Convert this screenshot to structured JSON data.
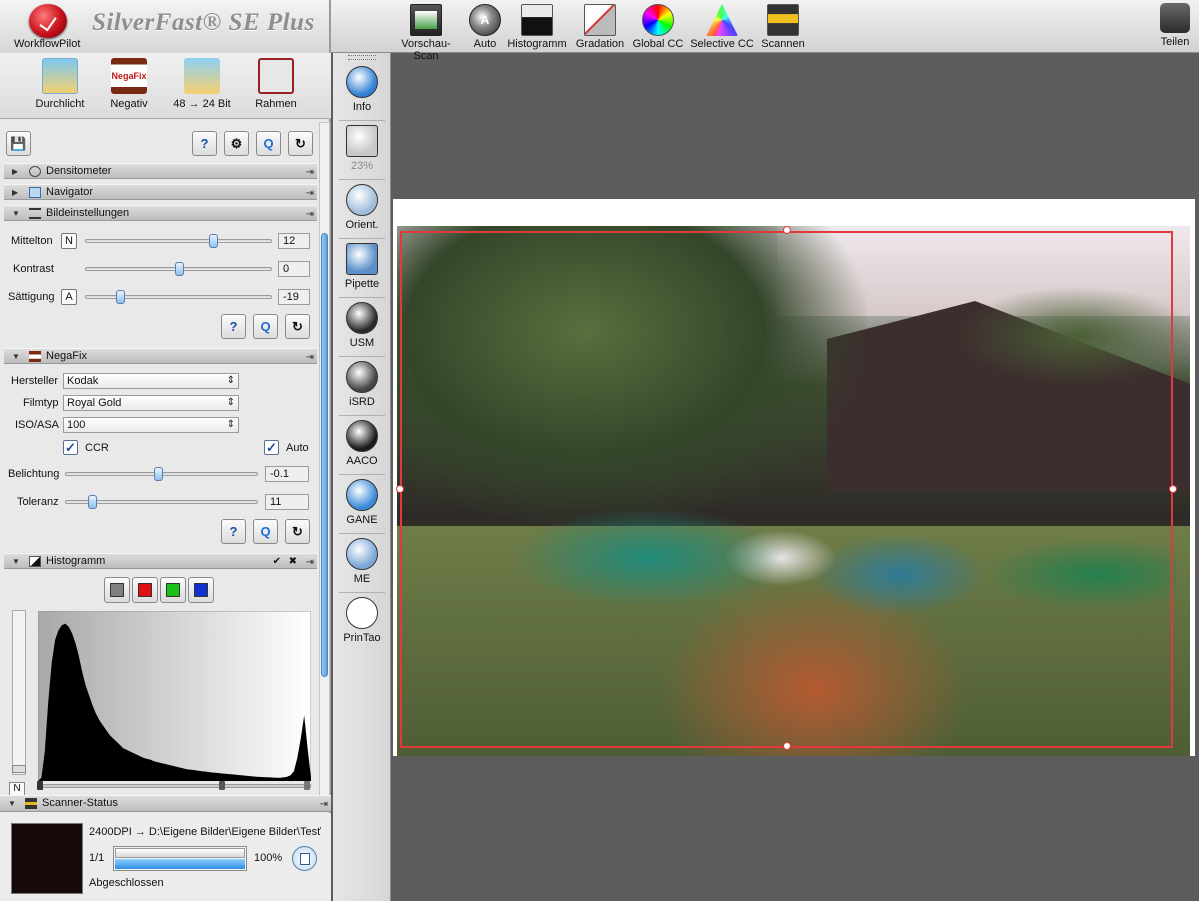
{
  "app": {
    "title": "SilverFast® SE Plus",
    "workflow_label": "WorkflowPilot"
  },
  "top_toolbar": [
    {
      "label": "Vorschau-Scan",
      "icon": "preview-scan-icon"
    },
    {
      "label": "Auto",
      "icon": "auto-icon"
    },
    {
      "label": "Histogramm",
      "icon": "histogram-icon"
    },
    {
      "label": "Gradation",
      "icon": "gradation-icon"
    },
    {
      "label": "Global CC",
      "icon": "global-cc-icon"
    },
    {
      "label": "Selective CC",
      "icon": "selective-cc-icon"
    },
    {
      "label": "Scannen",
      "icon": "scan-icon"
    }
  ],
  "share_label": "Teilen",
  "modes": [
    {
      "label": "Durchlicht",
      "icon": "transparency-icon"
    },
    {
      "label": "Negativ",
      "icon": "negafix-icon",
      "badge": "NegaFix"
    },
    {
      "label": "48 → 24 Bit",
      "icon": "bitdepth-icon"
    },
    {
      "label": "Rahmen",
      "icon": "frame-icon"
    }
  ],
  "sections": {
    "densitometer": "Densitometer",
    "navigator": "Navigator",
    "bildeinstellungen": "Bildeinstellungen",
    "negafix": "NegaFix",
    "histogramm": "Histogramm",
    "scanner_status": "Scanner-Status"
  },
  "image_settings": {
    "mittelton": {
      "label": "Mittelton",
      "letter": "N",
      "value": "12",
      "position": 0.69
    },
    "kontrast": {
      "label": "Kontrast",
      "value": "0",
      "position": 0.5
    },
    "saettigung": {
      "label": "Sättigung",
      "letter": "A",
      "value": "-19",
      "position": 0.17
    }
  },
  "negafix": {
    "hersteller_label": "Hersteller",
    "hersteller": "Kodak",
    "filmtyp_label": "Filmtyp",
    "filmtyp": "Royal Gold",
    "iso_label": "ISO/ASA",
    "iso": "100",
    "ccr_label": "CCR",
    "ccr_checked": true,
    "auto_label": "Auto",
    "auto_checked": true,
    "belichtung": {
      "label": "Belichtung",
      "value": "-0.1",
      "position": 0.48
    },
    "toleranz": {
      "label": "Toleranz",
      "value": "11",
      "position": 0.12
    }
  },
  "histogram": {
    "channel_buttons": [
      "#7f7f7f",
      "#e01010",
      "#18c018",
      "#1030d0"
    ],
    "n_label": "N",
    "bins": [
      0,
      2,
      18,
      48,
      72,
      86,
      92,
      95,
      96,
      94,
      90,
      84,
      76,
      66,
      58,
      52,
      46,
      41,
      37,
      34,
      31,
      28,
      26,
      24,
      22,
      20,
      19,
      18,
      17,
      16,
      15,
      14,
      13.5,
      13,
      12,
      11.5,
      11,
      10.5,
      10,
      9.5,
      9,
      8.5,
      8,
      7.5,
      7,
      6.8,
      6.5,
      6.2,
      6,
      5.8,
      5.5,
      5.2,
      5,
      4.8,
      4.6,
      4.4,
      4.2,
      4,
      3.8,
      3.6,
      3.4,
      3.2,
      3,
      2.8,
      2.6,
      2.5,
      2.4,
      2.3,
      2.2,
      2.1,
      2,
      2,
      2.2,
      2.6,
      3.5,
      6,
      14,
      26,
      40,
      20,
      2
    ]
  },
  "scanner_status": {
    "path": "2400DPI → D:\\Eigene Bilder\\Eigene Bilder\\Test\\T",
    "count": "1/1",
    "percent": "100%",
    "progress": 1.0,
    "status": "Abgeschlossen"
  },
  "tools": [
    {
      "label": "Info",
      "icon": "info-icon",
      "color": "#2f7fd4"
    },
    {
      "label": "23%",
      "icon": "zoom-icon",
      "color": "#c8c8c8"
    },
    {
      "label": "Orient.",
      "icon": "compass-icon",
      "color": "#9fbcd8"
    },
    {
      "label": "Pipette",
      "icon": "pipette-icon",
      "color": "#5a8fc8"
    },
    {
      "label": "USM",
      "icon": "usm-icon",
      "color": "#2a2a2a"
    },
    {
      "label": "iSRD",
      "icon": "isrd-icon",
      "color": "#444444"
    },
    {
      "label": "AACO",
      "icon": "aaco-icon",
      "color": "#1a1a1a"
    },
    {
      "label": "GANE",
      "icon": "gane-icon",
      "color": "#3b8ad8"
    },
    {
      "label": "ME",
      "icon": "multi-exposure-icon",
      "color": "#7aa7d8"
    },
    {
      "label": "PrinTao",
      "icon": "printao-icon",
      "color": "#ffffff"
    }
  ]
}
